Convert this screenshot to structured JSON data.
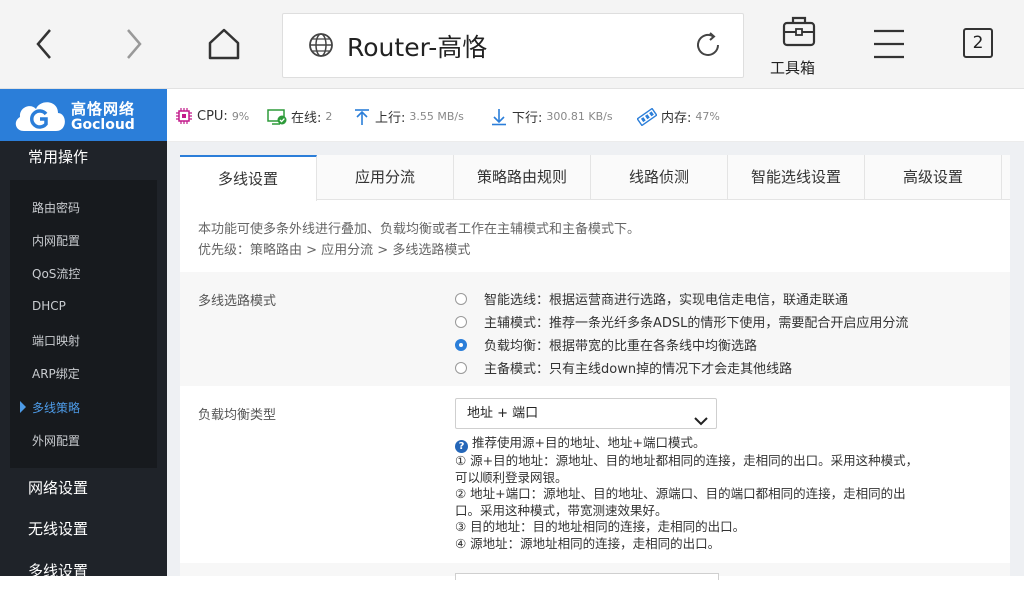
{
  "browser": {
    "url_text": "Router-高恪",
    "toolbox_label": "工具箱",
    "tab_count": "2"
  },
  "brand": {
    "name_cn": "高恪网络",
    "name_en": "Gocloud"
  },
  "status": {
    "cpu_label": "CPU:",
    "cpu_value": "9%",
    "online_label": "在线:",
    "online_value": "2",
    "up_label": "上行:",
    "up_value": "3.55 MB/s",
    "down_label": "下行:",
    "down_value": "300.81 KB/s",
    "mem_label": "内存:",
    "mem_value": "47%"
  },
  "sidebar": {
    "section_common": "常用操作",
    "items": [
      "路由密码",
      "内网配置",
      "QoS流控",
      "DHCP",
      "端口映射",
      "ARP绑定",
      "多线策略",
      "外网配置"
    ],
    "active_item": "多线策略",
    "section_network": "网络设置",
    "section_wireless": "无线设置",
    "section_multiline": "多线设置"
  },
  "tabs": [
    "多线设置",
    "应用分流",
    "策略路由规则",
    "线路侦测",
    "智能选线设置",
    "高级设置"
  ],
  "active_tab": "多线设置",
  "description": {
    "line1": "本功能可使多条外线进行叠加、负载均衡或者工作在主辅模式和主备模式下。",
    "line2": "优先级：策略路由 > 应用分流 > 多线选路模式"
  },
  "mode": {
    "label": "多线选路模式",
    "options": [
      "智能选线：根据运营商进行选路，实现电信走电信，联通走联通",
      "主辅模式：推荐一条光纤多条ADSL的情形下使用，需要配合开启应用分流",
      "负载均衡：根据带宽的比重在各条线中均衡选路",
      "主备模式：只有主线down掉的情况下才会走其他线路"
    ],
    "selected_index": 2
  },
  "balance": {
    "label": "负载均衡类型",
    "selected": "地址 + 端口",
    "help_title": "推荐使用源+目的地址、地址+端口模式。",
    "help_lines": [
      "① 源+目的地址：源地址、目的地址都相同的连接，走相同的出口。采用这种模式，",
      "可以顺利登录网银。",
      "② 地址+端口：源地址、目的地址、源端口、目的端口都相同的连接，走相同的出",
      "口。采用这种模式，带宽测速效果好。",
      "③ 目的地址：目的地址相同的连接，走相同的出口。",
      "④ 源地址：源地址相同的连接，走相同的出口。"
    ]
  }
}
